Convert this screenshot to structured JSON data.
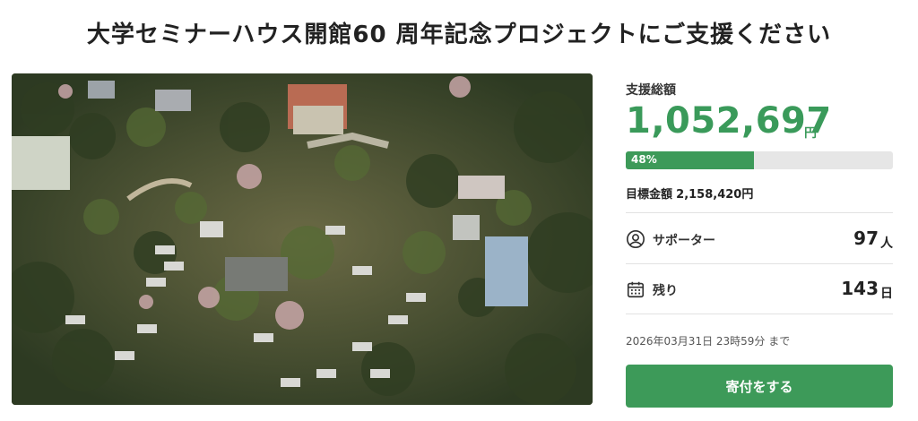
{
  "title": "大学セミナーハウス開館60 周年記念プロジェクトにご支援ください",
  "photo": {
    "alt": "大学セミナーハウス 航空写真"
  },
  "funding": {
    "label": "支援総額",
    "amount": "1,052,697",
    "amount_unit": "円",
    "progress_percent": 48,
    "progress_label": "48%",
    "goal_label": "目標金額",
    "goal_value": "2,158,420円"
  },
  "supporters": {
    "label": "サポーター",
    "value": "97",
    "unit": "人",
    "icon": "person-circle-icon"
  },
  "remaining": {
    "label": "残り",
    "value": "143",
    "unit": "日",
    "icon": "calendar-icon"
  },
  "deadline": "2026年03月31日 23時59分 まで",
  "donate_button": "寄付をする",
  "colors": {
    "accent": "#3d9a59",
    "amount": "#3a9a5a",
    "track": "#e6e6e6"
  }
}
